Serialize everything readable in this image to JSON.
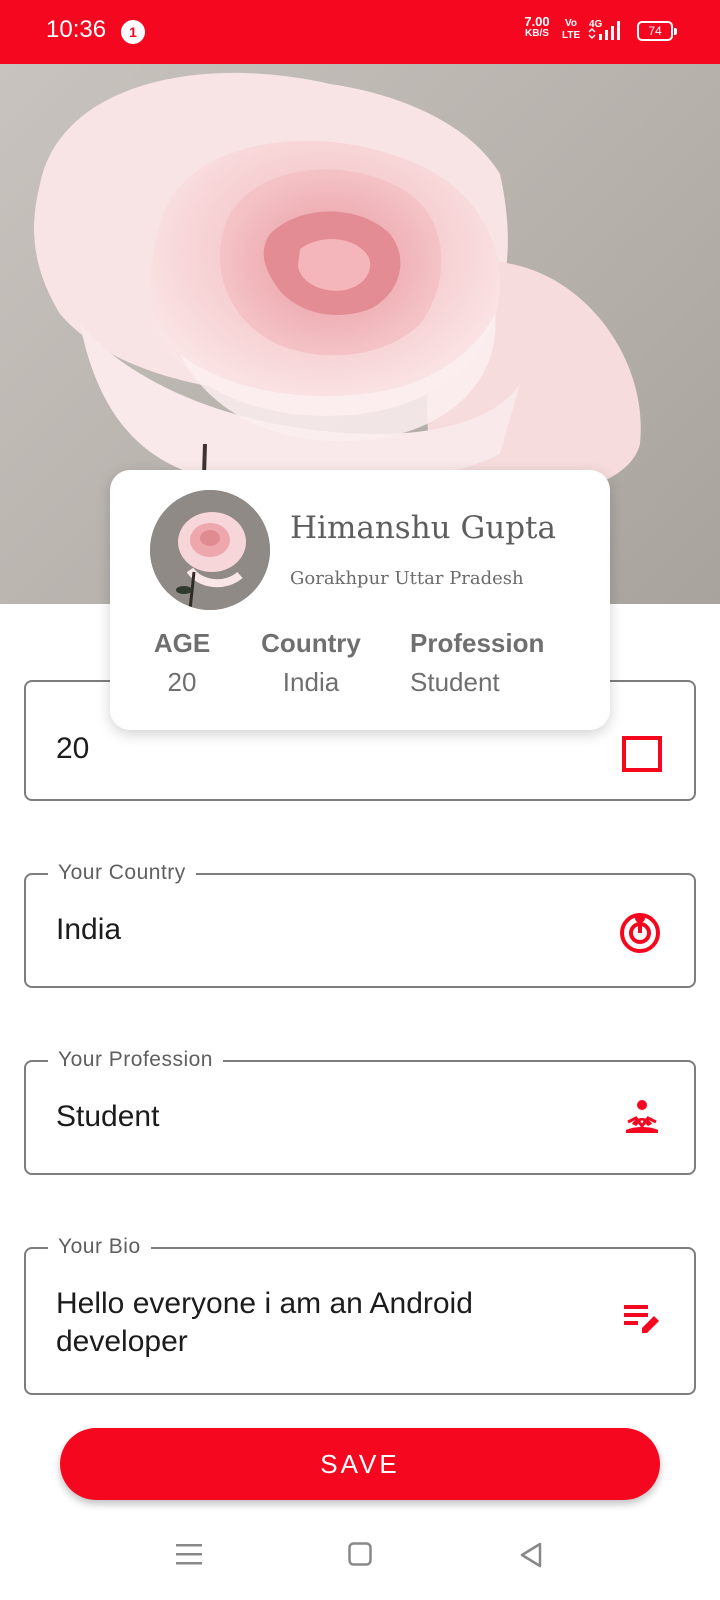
{
  "status_bar": {
    "time": "10:36",
    "notification_count": "1",
    "net_speed": "7.00",
    "net_speed_unit": "KB/S",
    "volte_top": "Vo",
    "volte_bottom": "LTE",
    "network": "4G",
    "battery": "74"
  },
  "profile": {
    "name": "Himanshu Gupta",
    "location": "Gorakhpur Uttar Pradesh",
    "stats": [
      {
        "label": "AGE",
        "value": "20"
      },
      {
        "label": "Country",
        "value": "India"
      },
      {
        "label": "Profession",
        "value": "Student"
      }
    ]
  },
  "form": {
    "age": {
      "value": "20",
      "icon": "calendar-icon"
    },
    "country": {
      "label": "Your Country",
      "value": "India",
      "icon": "location-target-icon"
    },
    "profession": {
      "label": "Your Profession",
      "value": "Student",
      "icon": "person-meditation-icon"
    },
    "bio": {
      "label": "Your Bio",
      "value_line1": "Hello everyone i am an Android",
      "value_line2": "developer",
      "icon": "edit-notes-icon"
    },
    "save_label": "SAVE"
  },
  "colors": {
    "accent": "#f5071f",
    "field_border": "#7d7d7d",
    "text_gray": "#6f6f6f"
  }
}
